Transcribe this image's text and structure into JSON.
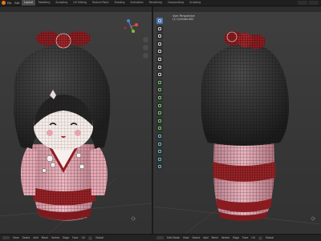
{
  "app": {
    "accent": "#e87d0d"
  },
  "menu": [
    "File",
    "Edit"
  ],
  "tabs": [
    {
      "label": "Layout",
      "active": true
    },
    {
      "label": "Modeling"
    },
    {
      "label": "Sculpting"
    },
    {
      "label": "UV Editing"
    },
    {
      "label": "Texture Paint"
    },
    {
      "label": "Shading"
    },
    {
      "label": "Animation"
    },
    {
      "label": "Rendering"
    },
    {
      "label": "Compositing"
    },
    {
      "label": "Scripting"
    }
  ],
  "viewport_right": {
    "info_line1": "User Perspective",
    "info_line2": "(1) Cylinder.002"
  },
  "statusbar_left": [
    "View",
    "Select",
    "Add",
    "Mesh",
    "Vertex",
    "Edge",
    "Face",
    "UV",
    "Global"
  ],
  "statusbar_right": [
    "Edit Mode",
    "View",
    "Select",
    "Add",
    "Mesh",
    "Vertex",
    "Edge",
    "Face",
    "UV",
    "Global"
  ],
  "colors": {
    "hair": "#2a2a2a",
    "face": "#f3e9e7",
    "kimono": "#e6a8b5",
    "obi": "#8f1e22",
    "bow": "#8b1d21",
    "wire": "#111111",
    "gizmo_x": "#e44b4b",
    "gizmo_y": "#7fbf3a",
    "gizmo_z": "#4a86d8"
  }
}
